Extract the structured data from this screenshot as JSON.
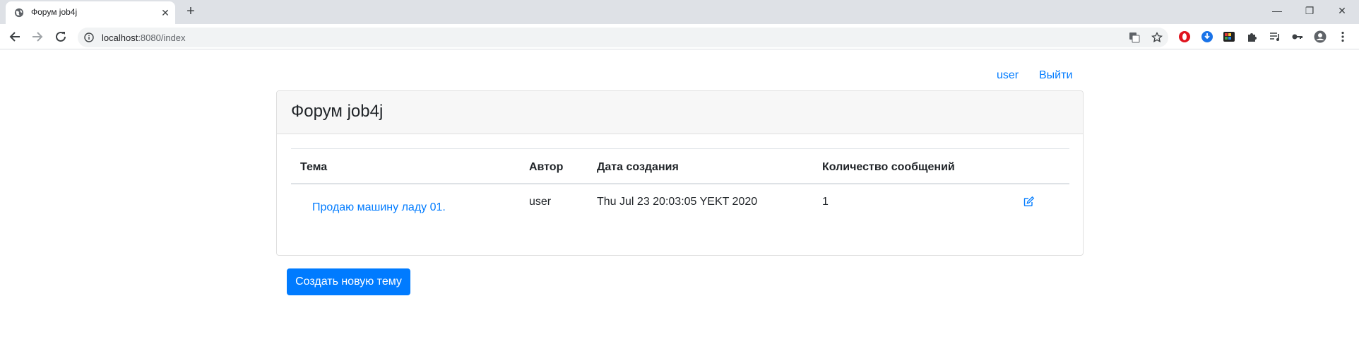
{
  "browser": {
    "tab_title": "Форум job4j",
    "tab_close": "✕",
    "new_tab": "+",
    "url_host": "localhost",
    "url_rest": ":8080/index"
  },
  "window_controls": {
    "minimize": "—",
    "restore": "❐",
    "close": "✕"
  },
  "header": {
    "user_link": "user",
    "logout_link": "Выйти"
  },
  "card": {
    "title": "Форум job4j"
  },
  "table": {
    "columns": [
      "Тема",
      "Автор",
      "Дата создания",
      "Количество сообщений"
    ],
    "rows": [
      {
        "topic": "Продаю машину ладу 01.",
        "author": "user",
        "created": "Thu Jul 23 20:03:05 YEKT 2020",
        "count": "1",
        "action_icon": "edit-icon"
      }
    ]
  },
  "actions": {
    "create_topic": "Создать новую тему"
  },
  "colors": {
    "link": "#007bff",
    "primary_button": "#007bff",
    "card_header_bg": "#f7f7f7"
  }
}
